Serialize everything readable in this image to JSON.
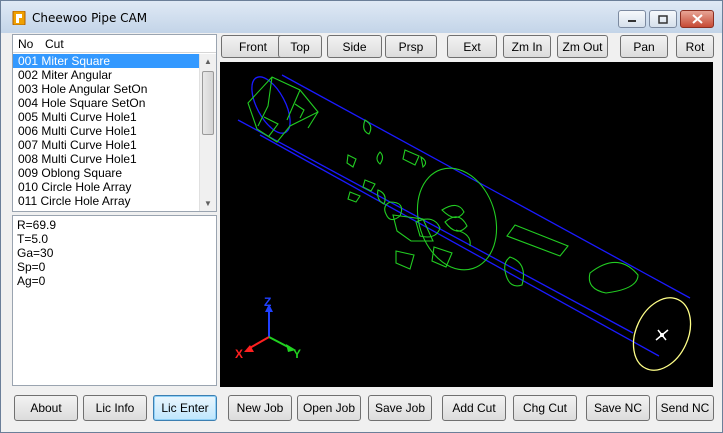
{
  "window": {
    "title": "Cheewoo Pipe CAM"
  },
  "list": {
    "headers": {
      "no": "No",
      "cut": "Cut"
    },
    "items": [
      "001 Miter Square",
      "002 Miter Angular",
      "003 Hole Angular SetOn",
      "004 Hole Square SetOn",
      "005 Multi Curve Hole1",
      "006 Multi Curve Hole1",
      "007 Multi Curve Hole1",
      "008 Multi Curve Hole1",
      "009 Oblong Square",
      "010 Circle Hole Array",
      "011 Circle Hole Array"
    ],
    "selected_index": 0
  },
  "params": [
    "R=69.9",
    "T=5.0",
    "Ga=30",
    "Sp=0",
    "Ag=0"
  ],
  "view_buttons": [
    "Front",
    "Top",
    "Side",
    "Prsp",
    "Ext",
    "Zm In",
    "Zm Out",
    "Pan",
    "Rot"
  ],
  "action_buttons": [
    "About",
    "Lic Info",
    "Lic Enter",
    "New Job",
    "Open Job",
    "Save Job",
    "Add Cut",
    "Chg Cut",
    "Save NC",
    "Send NC"
  ],
  "focused_button": "Lic Enter",
  "axes": {
    "x": "X",
    "y": "Y",
    "z": "Z"
  },
  "colors": {
    "viewport_bg": "#000000",
    "pipe": "#1a1aff",
    "cuts": "#22cc22",
    "end_circle": "#ffff88",
    "axis_x": "#ff2020",
    "axis_y": "#20d020",
    "axis_z": "#2040ff",
    "selection": "#3399ff"
  }
}
